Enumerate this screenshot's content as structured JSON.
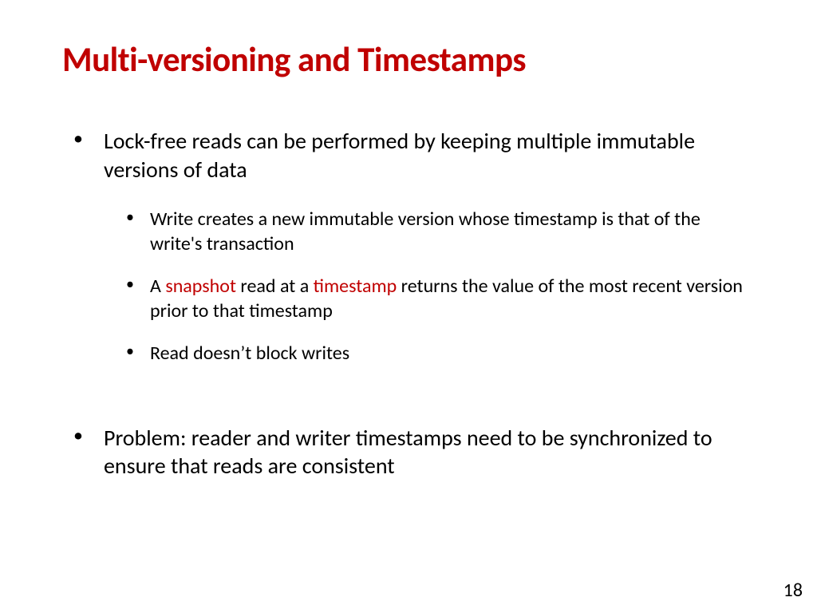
{
  "title": "Multi-versioning and Timestamps",
  "bullet1": "Lock-free reads can be performed by keeping multiple immutable versions of data",
  "sub1": "Write creates a new immutable version whose timestamp is that of the write's transaction",
  "sub2_a": "A ",
  "sub2_hl1": "snapshot",
  "sub2_b": " read at a ",
  "sub2_hl2": "timestamp",
  "sub2_c": " returns the value of the most recent version prior to that timestamp",
  "sub3": "Read doesn’t block writes",
  "bullet2": "Problem: reader and writer timestamps need to be synchronized to ensure that reads are consistent",
  "pagenum": "18"
}
